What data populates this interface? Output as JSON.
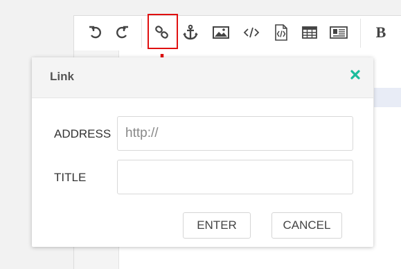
{
  "toolbar": {
    "icons": [
      "undo-icon",
      "redo-icon",
      "link-icon",
      "anchor-icon",
      "image-icon",
      "code-icon",
      "code-file-icon",
      "table-icon",
      "news-icon"
    ],
    "bold_label": "B"
  },
  "dialog": {
    "title": "Link",
    "address_label": "ADDRESS",
    "address_placeholder": "http://",
    "address_value": "",
    "title_label": "TITLE",
    "title_placeholder": "",
    "title_value": "",
    "enter_label": "ENTER",
    "cancel_label": "CANCEL"
  },
  "colors": {
    "close": "#1abc9c",
    "highlight": "#e01010",
    "selection": "#e8ecf6"
  }
}
